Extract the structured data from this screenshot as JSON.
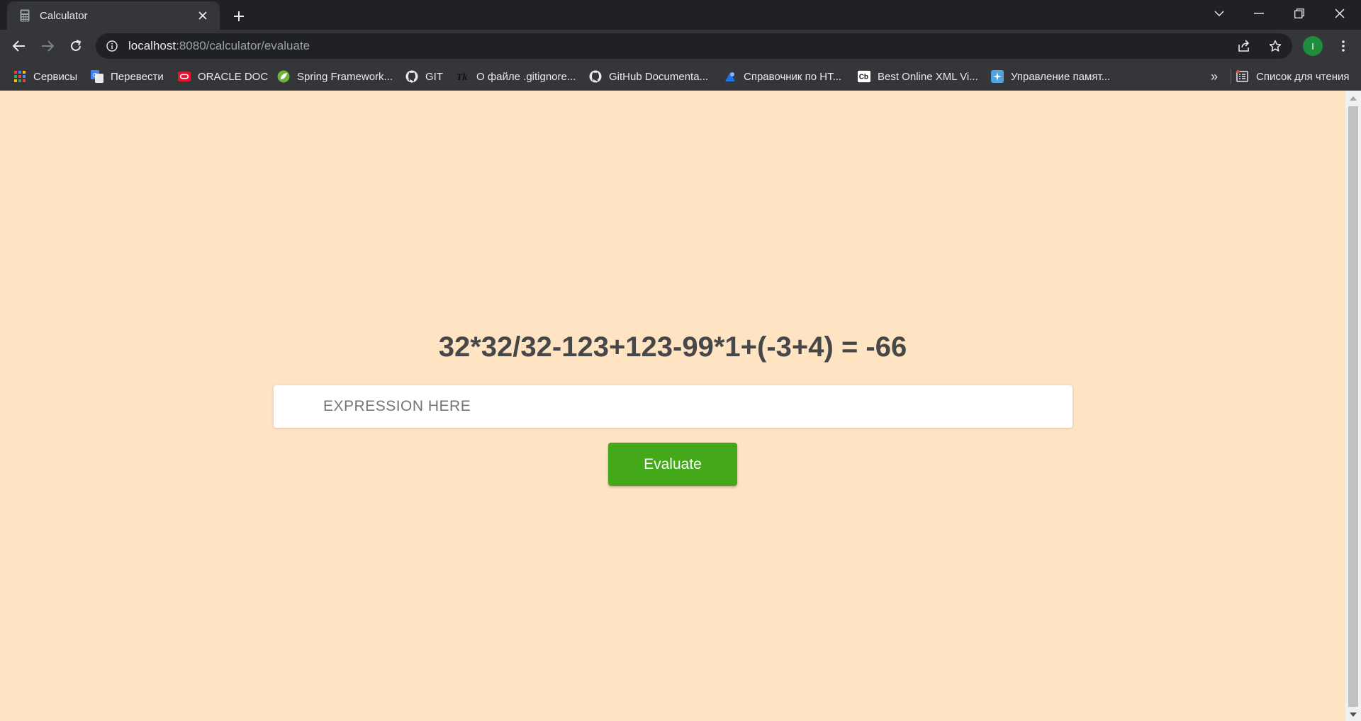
{
  "browser": {
    "tab": {
      "title": "Calculator",
      "favicon": "calculator-icon"
    },
    "address": {
      "host": "localhost",
      "path": ":8080/calculator/evaluate"
    },
    "profile_initial": "I",
    "bookmarks": [
      {
        "label": "Сервисы",
        "icon": "apps-grid-icon"
      },
      {
        "label": "Перевести",
        "icon": "google-translate-icon"
      },
      {
        "label": "ORACLE DOC",
        "icon": "oracle-icon"
      },
      {
        "label": "Spring Framework...",
        "icon": "spring-leaf-icon"
      },
      {
        "label": "GIT",
        "icon": "github-icon"
      },
      {
        "label": "О файле .gitignore...",
        "icon": "tk-icon"
      },
      {
        "label": "GitHub Documenta...",
        "icon": "github-icon"
      },
      {
        "label": "Справочник по HT...",
        "icon": "bookmark-site-icon"
      },
      {
        "label": "Best Online XML Vi...",
        "icon": "cb-icon"
      },
      {
        "label": "Управление памят...",
        "icon": "sparkle-icon"
      }
    ],
    "more_bookmarks": "»",
    "reading_list": {
      "label": "Список для чтения",
      "icon": "reading-list-icon"
    }
  },
  "page": {
    "result_text": "32*32/32-123+123-99*1+(-3+4) = -66",
    "expression_input": {
      "placeholder": "EXPRESSION HERE",
      "value": ""
    },
    "evaluate_label": "Evaluate",
    "colors": {
      "background": "#ffe4c4",
      "button": "#43a91a",
      "text": "#474747"
    }
  }
}
